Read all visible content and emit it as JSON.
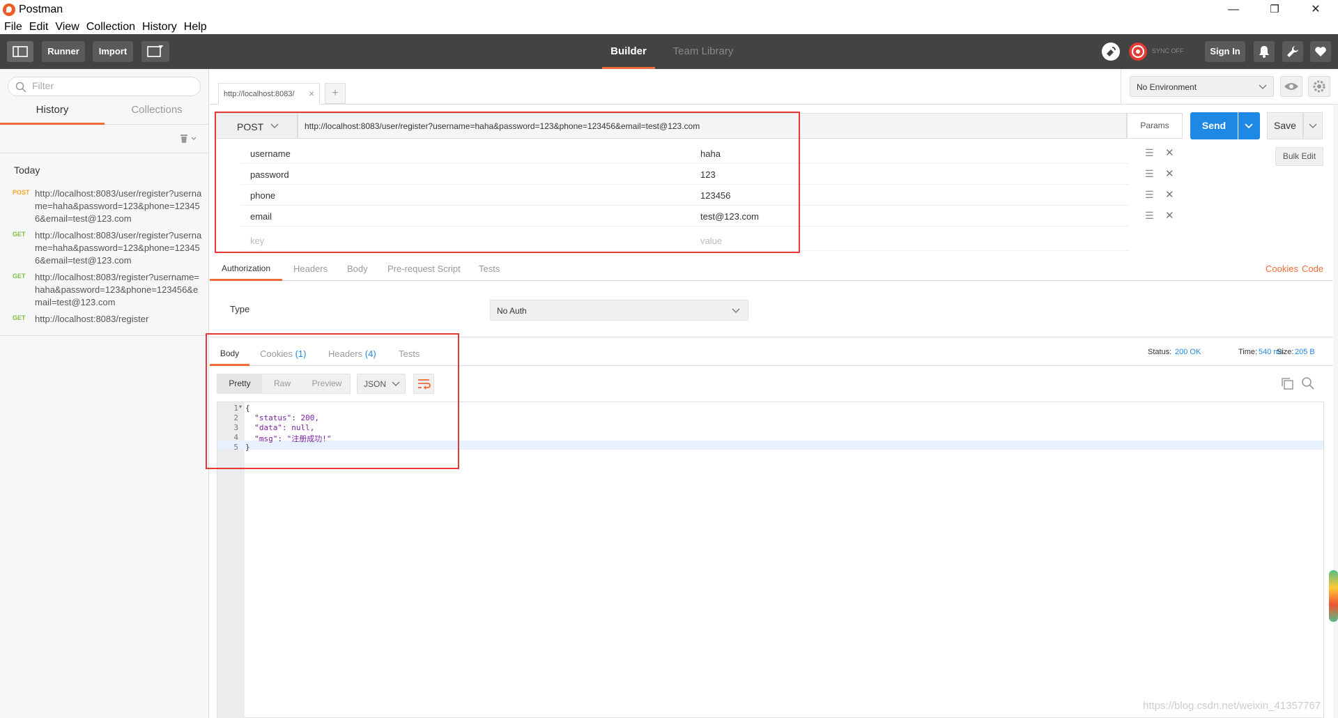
{
  "window": {
    "title": "Postman",
    "minimize": "—",
    "maximize": "❐",
    "close": "✕"
  },
  "menu": [
    "File",
    "Edit",
    "View",
    "Collection",
    "History",
    "Help"
  ],
  "toolbar": {
    "runner": "Runner",
    "import": "Import",
    "tabs": [
      "Builder",
      "Team Library"
    ],
    "sync": "SYNC OFF",
    "signin": "Sign In",
    "accent": "#f26b3a"
  },
  "sidebar": {
    "filter_placeholder": "Filter",
    "tabs": [
      "History",
      "Collections"
    ],
    "group": "Today",
    "items": [
      {
        "method": "POST",
        "color": "#f5a623",
        "url": "http://localhost:8083/user/register?username=haha&password=123&phone=123456&email=test@123.com"
      },
      {
        "method": "GET",
        "color": "#7ac142",
        "url": "http://localhost:8083/user/register?username=haha&password=123&phone=123456&email=test@123.com"
      },
      {
        "method": "GET",
        "color": "#7ac142",
        "url": "http://localhost:8083/register?username=haha&password=123&phone=123456&email=test@123.com"
      },
      {
        "method": "GET",
        "color": "#7ac142",
        "url": "http://localhost:8083/register"
      }
    ]
  },
  "request": {
    "tab_label": "http://localhost:8083/",
    "env": "No Environment",
    "method": "POST",
    "url": "http://localhost:8083/user/register?username=haha&password=123&phone=123456&email=test@123.com",
    "params": "Params",
    "send": "Send",
    "save": "Save",
    "bulk_edit": "Bulk Edit",
    "rows": [
      {
        "key": "username",
        "value": "haha"
      },
      {
        "key": "password",
        "value": "123"
      },
      {
        "key": "phone",
        "value": "123456"
      },
      {
        "key": "email",
        "value": "test@123.com"
      }
    ],
    "key_placeholder": "key",
    "value_placeholder": "value",
    "subtabs": [
      "Authorization",
      "Headers",
      "Body",
      "Pre-request Script",
      "Tests"
    ],
    "links": [
      "Cookies",
      "Code"
    ],
    "auth_type_label": "Type",
    "auth_type": "No Auth"
  },
  "response": {
    "tabs": [
      "Body",
      "Cookies",
      "Headers",
      "Tests"
    ],
    "cookies_count": "(1)",
    "headers_count": "(4)",
    "status_label": "Status:",
    "status": "200 OK",
    "time_label": "Time:",
    "time": "540 ms",
    "size_label": "Size:",
    "size": "205 B",
    "views": [
      "Pretty",
      "Raw",
      "Preview"
    ],
    "format": "JSON",
    "line_numbers": [
      "1",
      "2",
      "3",
      "4",
      "5"
    ],
    "code": [
      "{",
      "  \"status\": 200,",
      "  \"data\": null,",
      "  \"msg\": \"注册成功!\"",
      "}"
    ]
  },
  "watermark": "https://blog.csdn.net/weixin_41357767"
}
